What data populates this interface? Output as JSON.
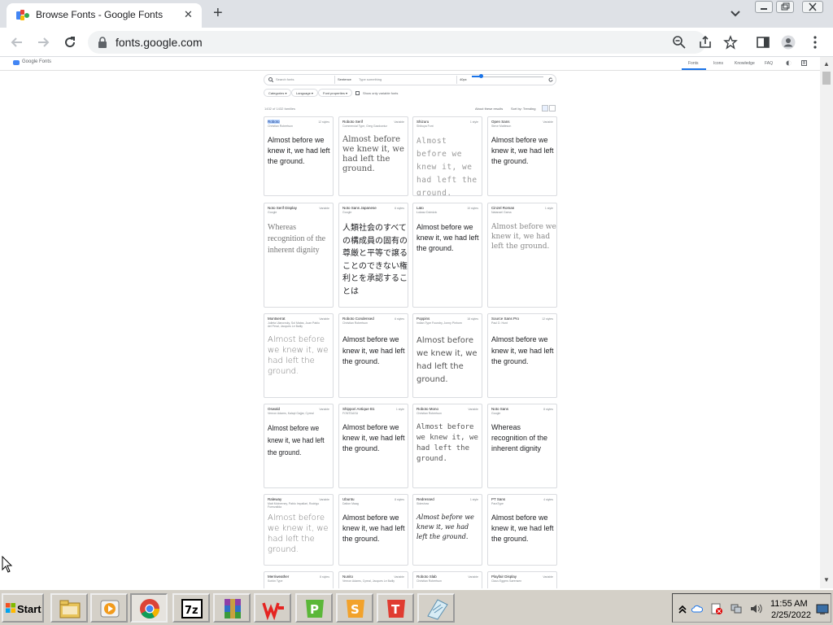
{
  "browser": {
    "tab_title": "Browse Fonts - Google Fonts",
    "url": "fonts.google.com",
    "new_tab_symbol": "+",
    "close_tab_symbol": "✕"
  },
  "gf": {
    "logo_text": "Google Fonts",
    "nav": [
      "Fonts",
      "Icons",
      "Knowledge",
      "FAQ"
    ]
  },
  "search": {
    "placeholder": "Search fonts",
    "sentence_label": "Sentence",
    "sentence_placeholder": "Type something",
    "size_label": "40px",
    "size_fraction": 0.12
  },
  "filters": {
    "chips": [
      "Categories",
      "Language",
      "Font properties"
    ],
    "checkbox_label": "Show only variable fonts"
  },
  "results": {
    "count": "1432 of 1432 families",
    "about": "About these results",
    "sort": "Sort by: Trending"
  },
  "cards": [
    {
      "name": "Roboto",
      "designer": "Christian Robertson",
      "styles": "12 styles",
      "sample": "Almost before we knew it, we had left the ground."
    },
    {
      "name": "Roboto Serif",
      "designer": "Commercial Type, Greg Gazdowicz",
      "styles": "Variable",
      "sample": "Almost before we knew it, we had left the ground."
    },
    {
      "name": "Shizuru",
      "designer": "Shibuya Font",
      "styles": "1 style",
      "sample": "Almost before we knew it, we had left the ground."
    },
    {
      "name": "Open Sans",
      "designer": "Steve Matteson",
      "styles": "Variable",
      "sample": "Almost before we knew it, we had left the ground."
    },
    {
      "name": "Noto Serif Display",
      "designer": "Google",
      "styles": "Variable",
      "sample": "Whereas recognition of the inherent dignity"
    },
    {
      "name": "Noto Sans Japanese",
      "designer": "Google",
      "styles": "6 styles",
      "sample": "人類社会のすべての構成員の固有の尊厳と平等で譲ることのできない権利とを承認することは"
    },
    {
      "name": "Lato",
      "designer": "Łukasz Dziedzic",
      "styles": "10 styles",
      "sample": "Almost before we knew it, we had left the ground."
    },
    {
      "name": "Cinzel Roman",
      "designer": "Natanael Gama",
      "styles": "1 style",
      "sample": "Almost before we knew it, we had left the ground."
    },
    {
      "name": "Montserrat",
      "designer": "Julieta Ulanovsky, Sol Matas, Juan Pablo del Peral, Jacques Le Bailly",
      "styles": "Variable",
      "sample": "Almost before we knew it, we had left the ground."
    },
    {
      "name": "Roboto Condensed",
      "designer": "Christian Robertson",
      "styles": "6 styles",
      "sample": "Almost before we knew it, we had left the ground."
    },
    {
      "name": "Poppins",
      "designer": "Indian Type Foundry, Jonny Pinhorn",
      "styles": "18 styles",
      "sample": "Almost before we knew it, we had left the ground."
    },
    {
      "name": "Source Sans Pro",
      "designer": "Paul D. Hunt",
      "styles": "12 styles",
      "sample": "Almost before we knew it, we had left the ground."
    },
    {
      "name": "Oswald",
      "designer": "Vernon Adams, Kalapi Gajjar, Cyreal",
      "styles": "Variable",
      "sample": "Almost before we knew it, we had left the ground."
    },
    {
      "name": "Shippori Antique B1",
      "designer": "FONTDASU",
      "styles": "1 style",
      "sample": "Almost before we knew it, we had left the ground."
    },
    {
      "name": "Roboto Mono",
      "designer": "Christian Robertson",
      "styles": "Variable",
      "sample": "Almost before we knew it, we had left the ground."
    },
    {
      "name": "Noto Sans",
      "designer": "Google",
      "styles": "8 styles",
      "sample": "Whereas recognition of the inherent dignity"
    },
    {
      "name": "Raleway",
      "designer": "Matt McInerney, Pablo Impallari, Rodrigo Fuenzalida",
      "styles": "Variable",
      "sample": "Almost before we knew it, we had left the ground."
    },
    {
      "name": "Ubuntu",
      "designer": "Dalton Maag",
      "styles": "8 styles",
      "sample": "Almost before we knew it, we had left the ground."
    },
    {
      "name": "Redressed",
      "designer": "Sideshow",
      "styles": "1 style",
      "sample": "Almost before we knew it, we had left the ground."
    },
    {
      "name": "PT Sans",
      "designer": "ParaType",
      "styles": "4 styles",
      "sample": "Almost before we knew it, we had left the ground."
    },
    {
      "name": "Merriweather",
      "designer": "Sorkin Type",
      "styles": "8 styles",
      "sample": ""
    },
    {
      "name": "Nunito",
      "designer": "Vernon Adams, Cyreal, Jacques Le Bailly",
      "styles": "Variable",
      "sample": ""
    },
    {
      "name": "Roboto Slab",
      "designer": "Christian Robertson",
      "styles": "Variable",
      "sample": ""
    },
    {
      "name": "Playfair Display",
      "designer": "Claus Eggers Sørensen",
      "styles": "Variable",
      "sample": ""
    }
  ],
  "taskbar": {
    "start": "Start",
    "time": "11:55 AM",
    "date": "2/25/2022",
    "apps": [
      "file-explorer",
      "media-player",
      "chrome",
      "7-zip",
      "winrar",
      "wps-office",
      "wps-presentation",
      "wps-spreadsheet",
      "wps-writer",
      "notepad"
    ]
  },
  "colors": {
    "accent": "#1a73e8",
    "tab_strip": "#dee1e6",
    "taskbar": "#d4d0c8"
  }
}
